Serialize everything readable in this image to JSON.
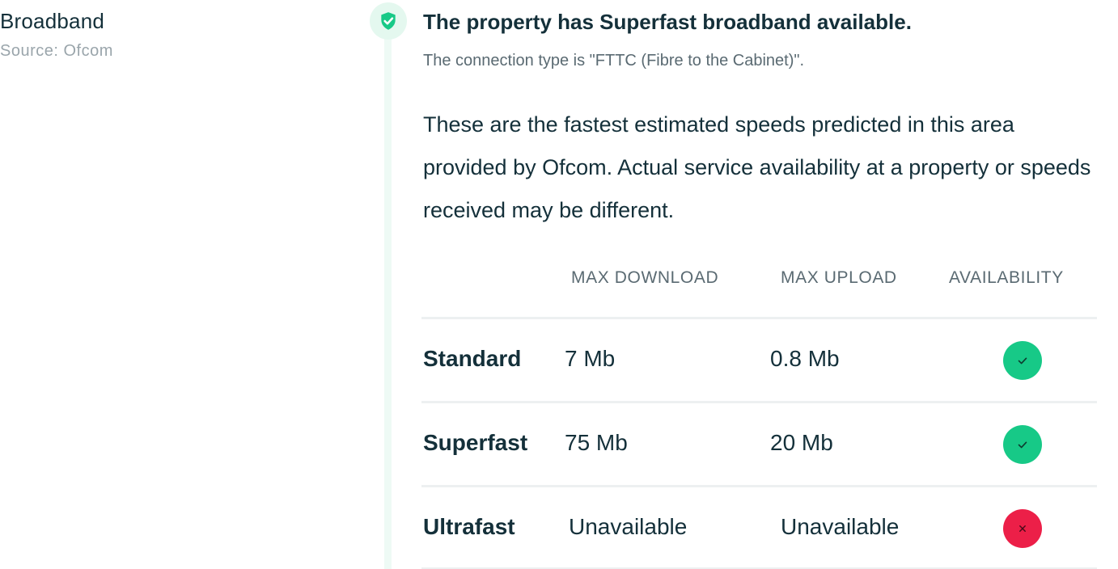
{
  "section": {
    "title": "Broadband",
    "source": "Source: Ofcom"
  },
  "headline": "The property has Superfast broadband available.",
  "connection": "The connection type is \"FTTC (Fibre to the Cabinet)\".",
  "explanation": "These are the fastest estimated speeds predicted in this area provided by Ofcom. Actual service availability at a property or speeds received may be different.",
  "table": {
    "columns": [
      "MAX DOWNLOAD",
      "MAX UPLOAD",
      "AVAILABILITY"
    ],
    "rows": [
      {
        "label": "Standard",
        "download": "7 Mb",
        "upload": "0.8 Mb",
        "available": true
      },
      {
        "label": "Superfast",
        "download": "75 Mb",
        "upload": "20 Mb",
        "available": true
      },
      {
        "label": "Ultrafast",
        "download": "Unavailable",
        "upload": "Unavailable",
        "available": false
      }
    ]
  },
  "icons": {
    "badge": "shield-check-icon",
    "available": "check-icon",
    "unavailable": "cross-icon"
  },
  "colors": {
    "accent_green": "#17c987",
    "error_red": "#ec1f48",
    "text_dark": "#14303a"
  }
}
